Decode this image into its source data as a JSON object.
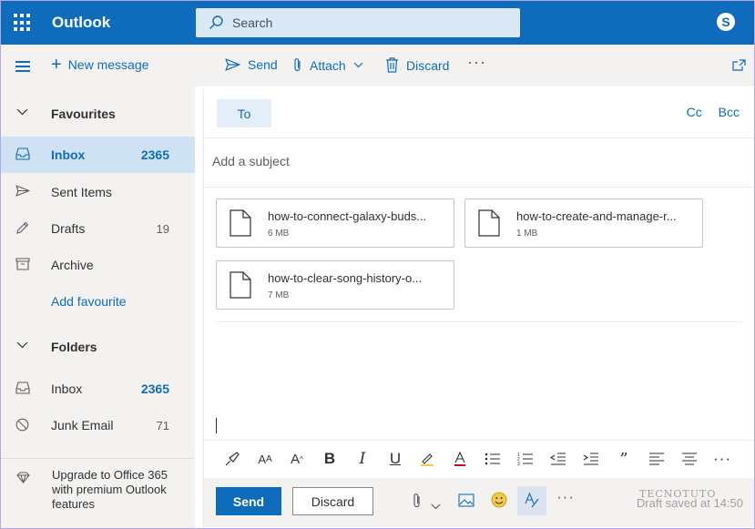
{
  "app": {
    "brand": "Outlook"
  },
  "search": {
    "placeholder": "Search"
  },
  "toolbar": {
    "new_message": "New message",
    "send": "Send",
    "attach": "Attach",
    "discard": "Discard",
    "more": "···"
  },
  "sidebar": {
    "favourites": "Favourites",
    "fav_items": [
      {
        "label": "Inbox",
        "count": "2365"
      },
      {
        "label": "Sent Items",
        "count": ""
      },
      {
        "label": "Drafts",
        "count": "19"
      },
      {
        "label": "Archive",
        "count": ""
      }
    ],
    "add_favourite": "Add favourite",
    "folders": "Folders",
    "folder_items": [
      {
        "label": "Inbox",
        "count": "2365"
      },
      {
        "label": "Junk Email",
        "count": "71"
      }
    ],
    "upgrade": "Upgrade to Office 365 with premium Outlook features"
  },
  "compose": {
    "to_label": "To",
    "cc": "Cc",
    "bcc": "Bcc",
    "subject_placeholder": "Add a subject",
    "attachments": [
      {
        "name": "how-to-connect-galaxy-buds...",
        "size": "6 MB"
      },
      {
        "name": "how-to-create-and-manage-r...",
        "size": "1 MB"
      },
      {
        "name": "how-to-clear-song-history-o...",
        "size": "7 MB"
      }
    ],
    "send_button": "Send",
    "discard_button": "Discard",
    "status": "Draft saved at 14:50"
  },
  "watermark": "TECNOTUTO",
  "colors": {
    "accent": "#0F6CBD",
    "selected_bg": "#cfe2f3",
    "pane_bg": "#f3f2f1"
  }
}
